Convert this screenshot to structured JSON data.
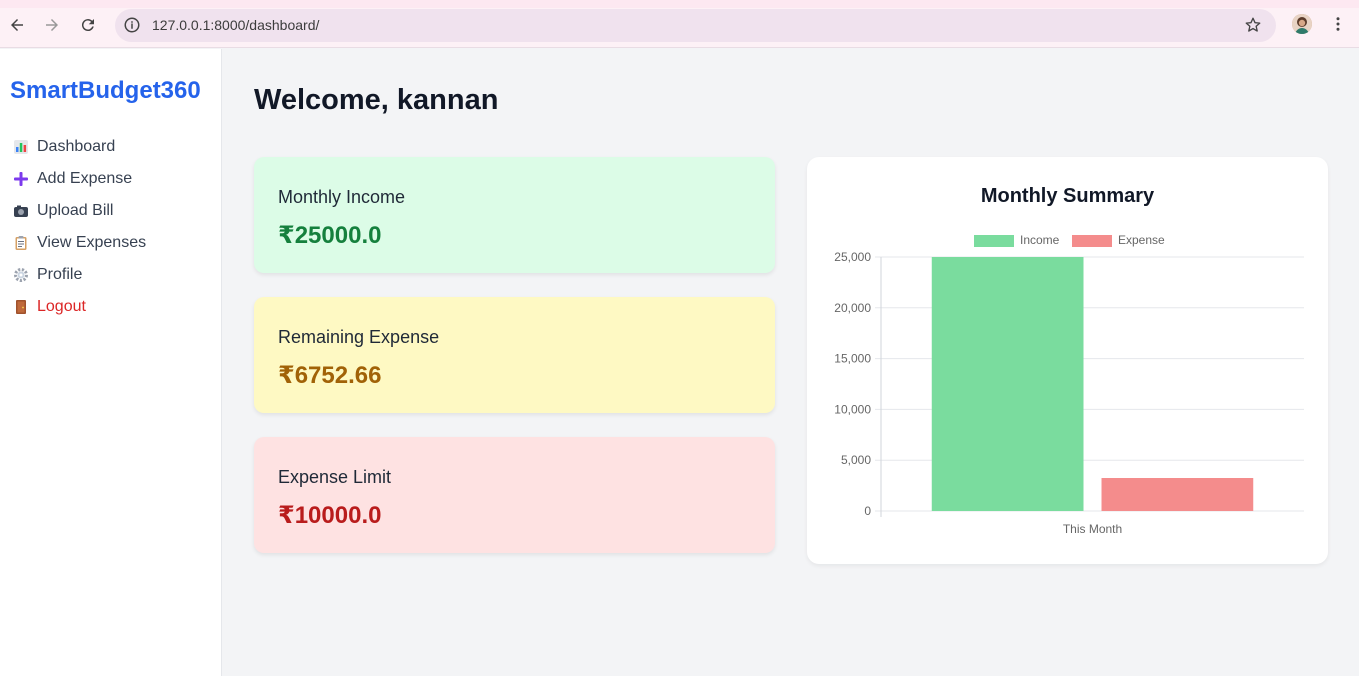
{
  "browser": {
    "url": "127.0.0.1:8000/dashboard/"
  },
  "sidebar": {
    "brand": "SmartBudget360",
    "items": [
      {
        "label": "Dashboard",
        "icon": "bar-chart-icon"
      },
      {
        "label": "Add Expense",
        "icon": "plus-icon"
      },
      {
        "label": "Upload Bill",
        "icon": "camera-icon"
      },
      {
        "label": "View Expenses",
        "icon": "clipboard-icon"
      },
      {
        "label": "Profile",
        "icon": "gear-icon"
      },
      {
        "label": "Logout",
        "icon": "door-icon"
      }
    ]
  },
  "main": {
    "welcome": "Welcome, kannan",
    "cards": {
      "income": {
        "title": "Monthly Income",
        "amount": "₹25000.0"
      },
      "remaining": {
        "title": "Remaining Expense",
        "amount": "₹6752.66"
      },
      "limit": {
        "title": "Expense Limit",
        "amount": "₹10000.0"
      }
    }
  },
  "colors": {
    "brand": "#2563eb",
    "income_bar": "#7adc9e",
    "expense_bar": "#f48c8c",
    "logout": "#dc2626"
  },
  "chart_data": {
    "type": "bar",
    "title": "Monthly Summary",
    "categories": [
      "This Month"
    ],
    "series": [
      {
        "name": "Income",
        "values": [
          25000
        ]
      },
      {
        "name": "Expense",
        "values": [
          3247.34
        ]
      }
    ],
    "ylim": [
      0,
      25000
    ],
    "yticks": [
      "25,000",
      "20,000",
      "15,000",
      "10,000",
      "5,000",
      "0"
    ],
    "legend": "top",
    "grid": true
  }
}
